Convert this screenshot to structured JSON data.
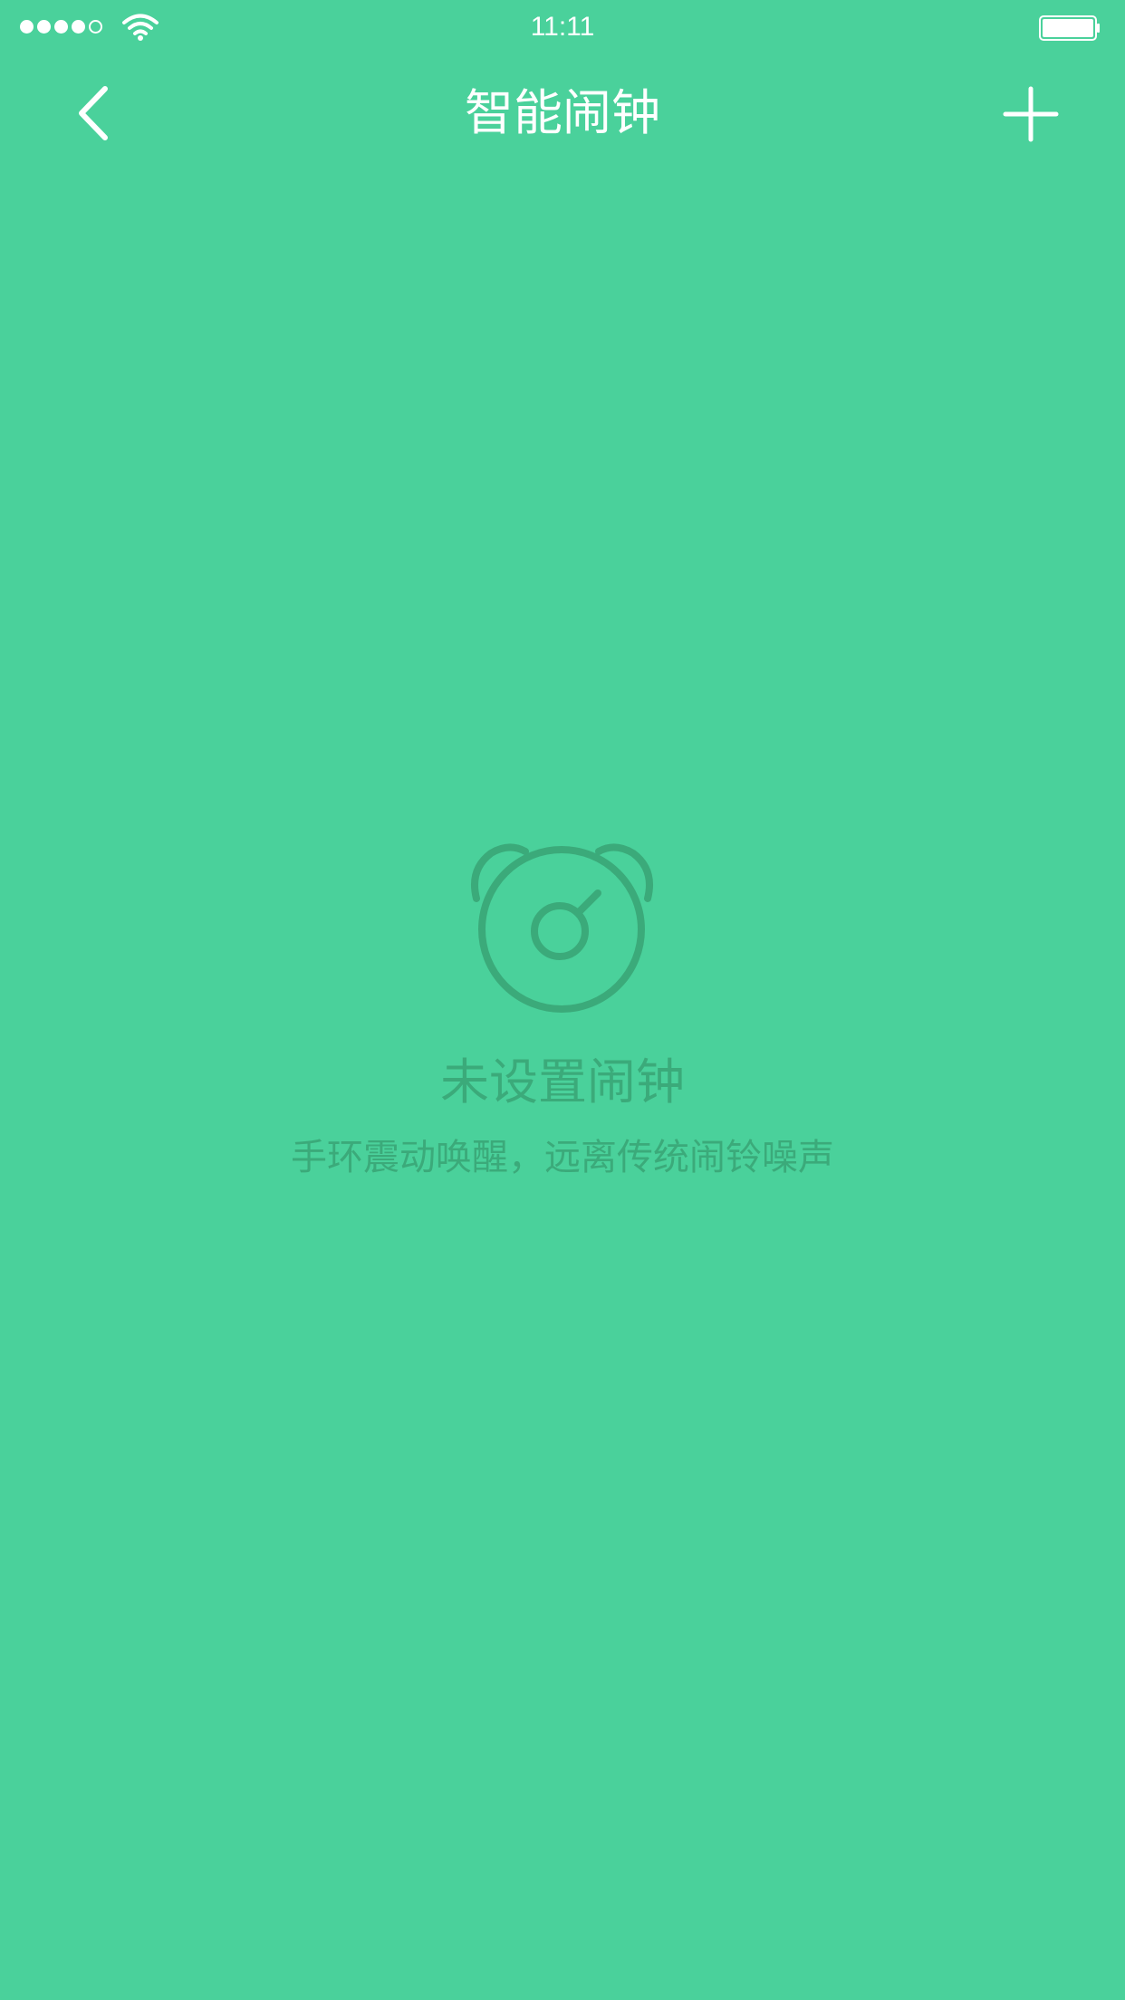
{
  "status_bar": {
    "time": "11:11",
    "signal_bars": 4,
    "signal_total": 5,
    "wifi_icon": "wifi-icon",
    "battery_level": 1.0
  },
  "nav": {
    "title": "智能闹钟",
    "back_icon": "chevron-left-icon",
    "add_icon": "plus-icon"
  },
  "empty_state": {
    "icon": "alarm-clock-icon",
    "title": "未设置闹钟",
    "subtitle": "手环震动唤醒，远离传统闹铃噪声"
  },
  "colors": {
    "background": "#4AD19B",
    "foreground": "#FFFFFF",
    "empty_text": "#3BAA7A"
  }
}
